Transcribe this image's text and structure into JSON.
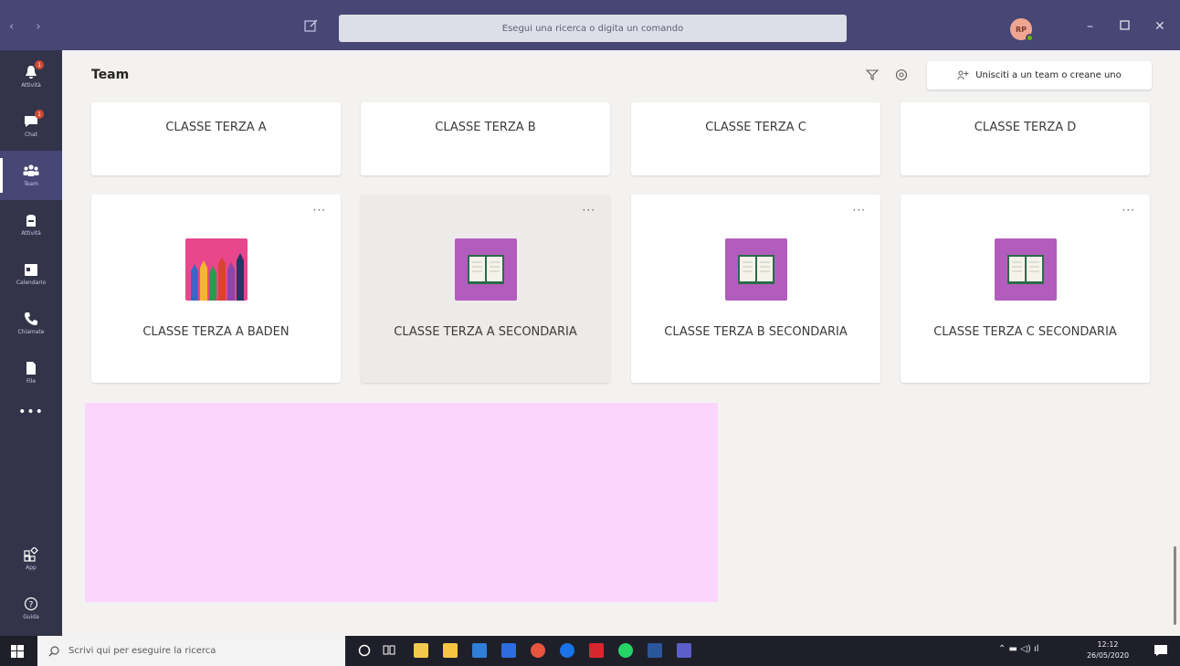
{
  "titlebar": {
    "search_placeholder": "Esegui una ricerca o digita un comando",
    "avatar_initials": "RP"
  },
  "rail": {
    "items": [
      {
        "label": "Attività",
        "icon": "bell-icon",
        "badge": "1"
      },
      {
        "label": "Chat",
        "icon": "chat-icon",
        "badge": "1"
      },
      {
        "label": "Team",
        "icon": "teams-icon",
        "active": true
      },
      {
        "label": "Attività",
        "icon": "assignments-icon"
      },
      {
        "label": "Calendario",
        "icon": "calendar-icon"
      },
      {
        "label": "Chiamate",
        "icon": "phone-icon"
      },
      {
        "label": "File",
        "icon": "file-icon"
      }
    ],
    "more": "•••",
    "apps_label": "App",
    "help_label": "Guida"
  },
  "main": {
    "title": "Team",
    "join_label": "Unisciti a un team o creane uno",
    "teams_row1": [
      {
        "name": "CLASSE TERZA A"
      },
      {
        "name": "CLASSE TERZA B"
      },
      {
        "name": "CLASSE TERZA C"
      },
      {
        "name": "CLASSE TERZA D"
      }
    ],
    "teams_row2": [
      {
        "name": "CLASSE TERZA A BADEN",
        "tile": "pencils"
      },
      {
        "name": "CLASSE TERZA A SECONDARIA",
        "tile": "book"
      },
      {
        "name": "CLASSE TERZA B SECONDARIA",
        "tile": "book"
      },
      {
        "name": "CLASSE TERZA C SECONDARIA",
        "tile": "book"
      }
    ],
    "more_label": "···"
  },
  "taskbar": {
    "search_placeholder": "Scrivi qui per eseguire la ricerca",
    "time": "12:12",
    "date": "26/05/2020"
  },
  "colors": {
    "titlebar": "#464775",
    "rail": "#33344a",
    "book_tile": "#b25dbd",
    "pencil_tile": "#e8478b",
    "highlight": "#fcd5fc"
  }
}
